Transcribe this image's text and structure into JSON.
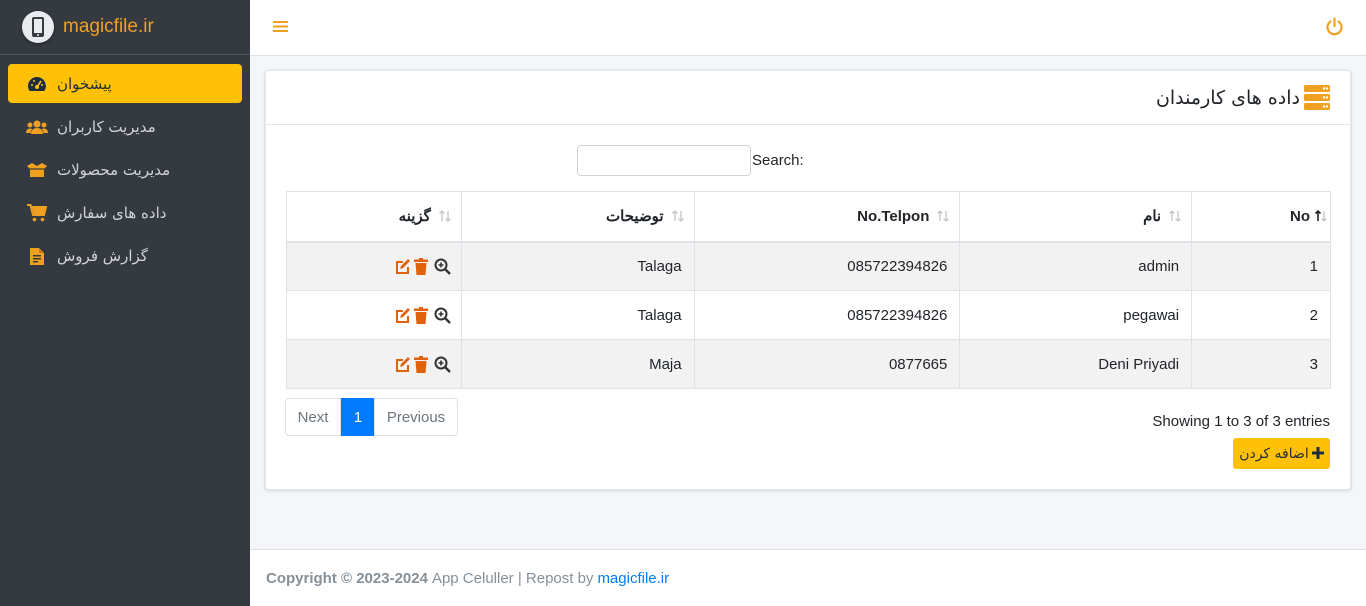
{
  "brand": {
    "name": "magicfile.ir",
    "icon": "mobile-phone-icon"
  },
  "sidebar": {
    "items": [
      {
        "label": "پیشخوان",
        "icon": "dashboard-icon",
        "active": true
      },
      {
        "label": "مدیریت کاربران",
        "icon": "users-icon"
      },
      {
        "label": "مدیریت محصولات",
        "icon": "box-open-icon"
      },
      {
        "label": "داده های سفارش",
        "icon": "cart-icon"
      },
      {
        "label": "گزارش فروش",
        "icon": "file-report-icon"
      }
    ]
  },
  "topbar": {
    "menu_icon": "hamburger-icon",
    "power_icon": "power-icon"
  },
  "card": {
    "title": "داده های کارمندان",
    "title_icon": "server-icon",
    "search_label": "Search:",
    "search_value": "",
    "columns": [
      "No",
      "نام",
      "No.Telpon",
      "توضیحات",
      "گزینه"
    ],
    "rows": [
      {
        "no": "1",
        "name": "admin",
        "phone": "085722394826",
        "desc": "Talaga"
      },
      {
        "no": "2",
        "name": "pegawai",
        "phone": "085722394826",
        "desc": "Talaga"
      },
      {
        "no": "3",
        "name": "Deni Priyadi",
        "phone": "0877665",
        "desc": "Maja"
      }
    ],
    "row_actions": [
      "edit-icon",
      "delete-icon",
      "zoom-icon"
    ],
    "pager": {
      "next": "Next",
      "current": "1",
      "previous": "Previous"
    },
    "info": "Showing 1 to 3 of 3 entries",
    "add_button": "اضافه کردن"
  },
  "footer": {
    "copyright": "Copyright © 2023-2024",
    "app": "App Celuller | Repost by",
    "link": "magicfile.ir"
  },
  "colors": {
    "accent": "#ffc107",
    "brand": "#f0a020",
    "sidebar": "#343a40",
    "primary": "#007bff",
    "action_icon": "#e0620d"
  }
}
